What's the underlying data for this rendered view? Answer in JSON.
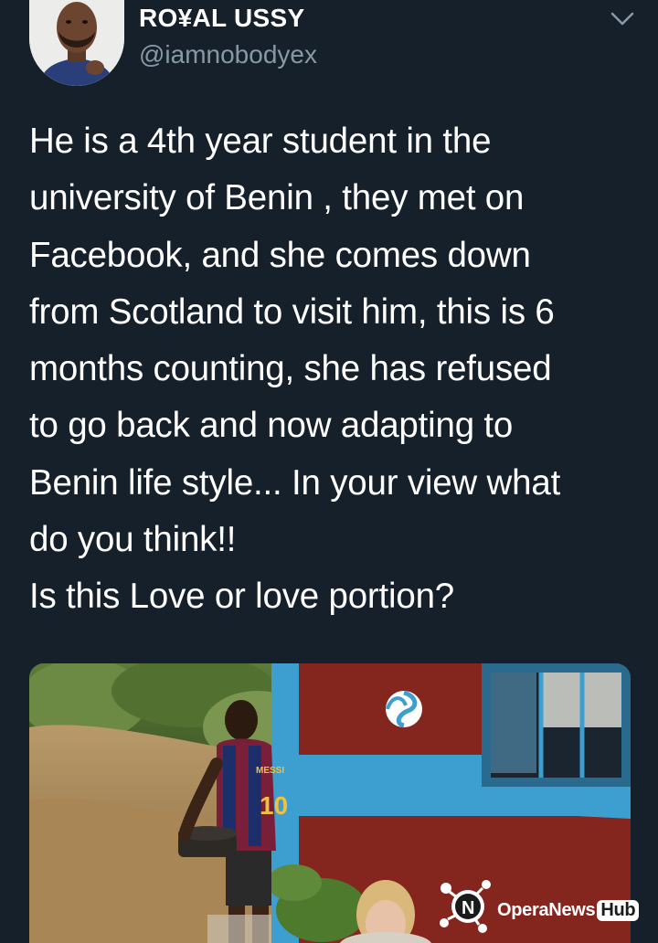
{
  "tweet": {
    "display_name": "RO¥AL USSY",
    "handle": "@iamnobodyex",
    "text_lines": [
      "He is a 4th year student in the",
      "university of Benin , they met on",
      "Facebook, and she comes down",
      "from Scotland to visit him, this is 6",
      "months counting, she has refused",
      "to go back and now adapting to",
      "Benin life style...  In your view what",
      "do you think!!",
      "Is this Love or love portion?"
    ],
    "jersey_name": "MESSI",
    "jersey_number": "10"
  },
  "watermark": {
    "brand": "OperaNews",
    "badge": "Hub"
  },
  "icons": {
    "menu": "chevron-down-icon",
    "logo": "operanews-logo-icon"
  },
  "colors": {
    "background": "#15202b",
    "text": "#ffffff",
    "secondary_text": "#8899a6"
  }
}
